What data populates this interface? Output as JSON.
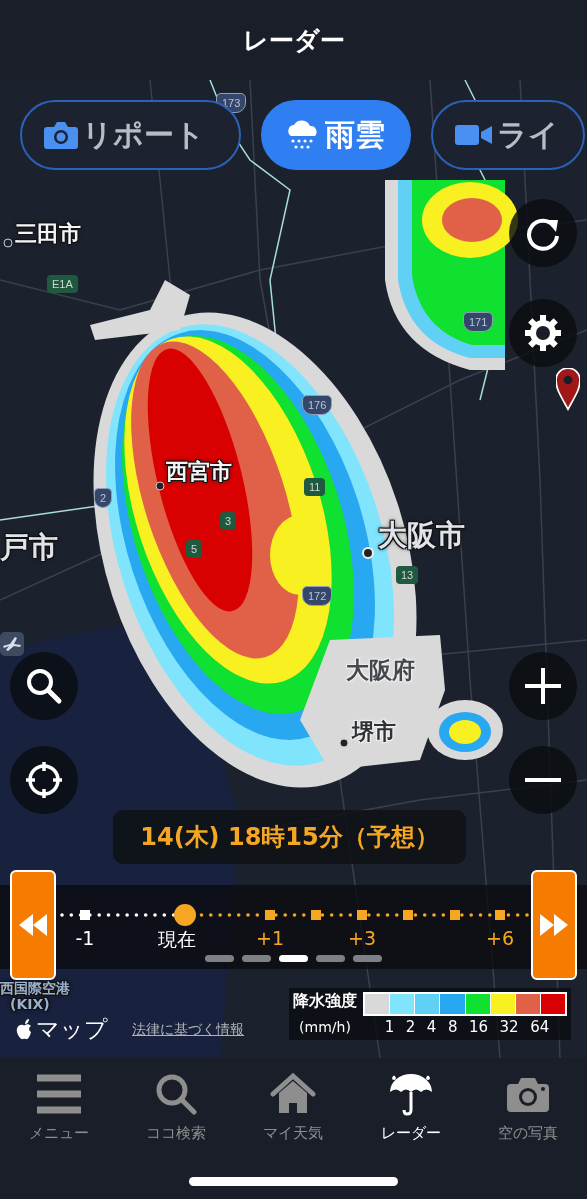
{
  "header": {
    "title": "レーダー"
  },
  "layer_tabs": [
    {
      "label": "リポート",
      "kind": "camera",
      "selected": false
    },
    {
      "label": "雨雲",
      "kind": "rain",
      "selected": true
    },
    {
      "label": "ライ",
      "kind": "video",
      "selected": false
    }
  ],
  "map": {
    "place_labels": [
      {
        "text": "三田市",
        "kind": "city"
      },
      {
        "text": "西宮市",
        "kind": "city"
      },
      {
        "text": "大阪市",
        "kind": "major"
      },
      {
        "text": "戸市",
        "kind": "major"
      },
      {
        "text": "大阪府",
        "kind": "region"
      },
      {
        "text": "堺市",
        "kind": "town"
      },
      {
        "text": "西国際空港",
        "kind": "airport"
      },
      {
        "text": "(KIX)",
        "kind": "airport"
      }
    ],
    "route_shields": [
      {
        "text": "173",
        "kind": "national"
      },
      {
        "text": "E1A",
        "kind": "expressway"
      },
      {
        "text": "171",
        "kind": "national"
      },
      {
        "text": "176",
        "kind": "national"
      },
      {
        "text": "2",
        "kind": "national"
      },
      {
        "text": "11",
        "kind": "expressway"
      },
      {
        "text": "3",
        "kind": "expressway"
      },
      {
        "text": "5",
        "kind": "expressway"
      },
      {
        "text": "172",
        "kind": "national"
      },
      {
        "text": "13",
        "kind": "expressway"
      }
    ]
  },
  "time_label": "14(木) 18時15分（予想）",
  "timeline": {
    "ticks": [
      {
        "label": "-1",
        "kind": "past",
        "selected": false
      },
      {
        "label": "現在",
        "kind": "past",
        "selected": true
      },
      {
        "label": "+1",
        "kind": "future",
        "selected": false
      },
      {
        "label": "+3",
        "kind": "future",
        "selected": false
      },
      {
        "label": "+6",
        "kind": "future",
        "selected": false
      }
    ],
    "pages": [
      {
        "selected": false
      },
      {
        "selected": false
      },
      {
        "selected": true
      },
      {
        "selected": false
      },
      {
        "selected": false
      }
    ]
  },
  "legend": {
    "title": "降水強度",
    "unit": "(mm/h)",
    "swatches": [
      {
        "color": "#d9d9d9"
      },
      {
        "color": "#80e4fc"
      },
      {
        "color": "#60d0f4"
      },
      {
        "color": "#28a8f0"
      },
      {
        "color": "#10e030"
      },
      {
        "color": "#f8f020"
      },
      {
        "color": "#e06048"
      },
      {
        "color": "#d80000"
      }
    ],
    "values": [
      "1",
      "2",
      "4",
      "8",
      "16",
      "32",
      "64"
    ]
  },
  "attribution": {
    "maps_label": "マップ",
    "legal_link": "法律に基づく情報"
  },
  "tab_bar": [
    {
      "label": "メニュー",
      "kind": "menu",
      "selected": false
    },
    {
      "label": "ココ検索",
      "kind": "search",
      "selected": false
    },
    {
      "label": "マイ天気",
      "kind": "home",
      "selected": false
    },
    {
      "label": "レーダー",
      "kind": "umbrella",
      "selected": true
    },
    {
      "label": "空の写真",
      "kind": "camera",
      "selected": false
    }
  ]
}
